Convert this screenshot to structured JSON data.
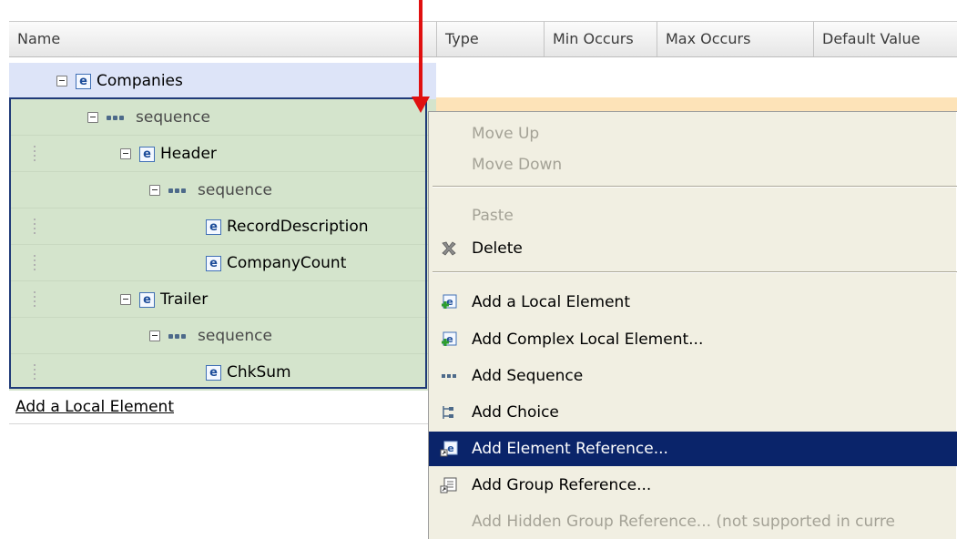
{
  "header": {
    "columns": [
      "Name",
      "Type",
      "Min Occurs",
      "Max Occurs",
      "Default Value"
    ]
  },
  "tree": {
    "root_label": "Companies",
    "rows": [
      {
        "label": "sequence",
        "kind": "sequence"
      },
      {
        "label": "Header",
        "kind": "element"
      },
      {
        "label": "sequence",
        "kind": "sequence"
      },
      {
        "label": "RecordDescription",
        "kind": "element"
      },
      {
        "label": "CompanyCount",
        "kind": "element"
      },
      {
        "label": "Trailer",
        "kind": "element"
      },
      {
        "label": "sequence",
        "kind": "sequence"
      },
      {
        "label": "ChkSum",
        "kind": "element"
      }
    ],
    "element_icon_letter": "e",
    "add_link": "Add a Local Element"
  },
  "menu": {
    "items": [
      {
        "label": "Move Up",
        "enabled": false
      },
      {
        "label": "Move Down",
        "enabled": false
      },
      {
        "label": "Paste",
        "enabled": false
      },
      {
        "label": "Delete",
        "enabled": true,
        "icon": "delete-icon"
      },
      {
        "label": "Add a Local Element",
        "enabled": true,
        "icon": "add-local-element-icon"
      },
      {
        "label": "Add Complex Local Element...",
        "enabled": true,
        "icon": "add-complex-element-icon"
      },
      {
        "label": "Add Sequence",
        "enabled": true,
        "icon": "sequence-icon"
      },
      {
        "label": "Add Choice",
        "enabled": true,
        "icon": "choice-icon"
      },
      {
        "label": "Add Element Reference...",
        "enabled": true,
        "highlighted": true,
        "icon": "element-reference-icon"
      },
      {
        "label": "Add Group Reference...",
        "enabled": true,
        "icon": "group-reference-icon"
      },
      {
        "label": "Add Hidden Group Reference... (not supported in curre",
        "enabled": false
      }
    ]
  },
  "colors": {
    "selection_bg": "#d4e4cc",
    "root_bg": "#dde4f8",
    "menu_highlight": "#0a246a",
    "annotation_arrow": "#e01010"
  }
}
